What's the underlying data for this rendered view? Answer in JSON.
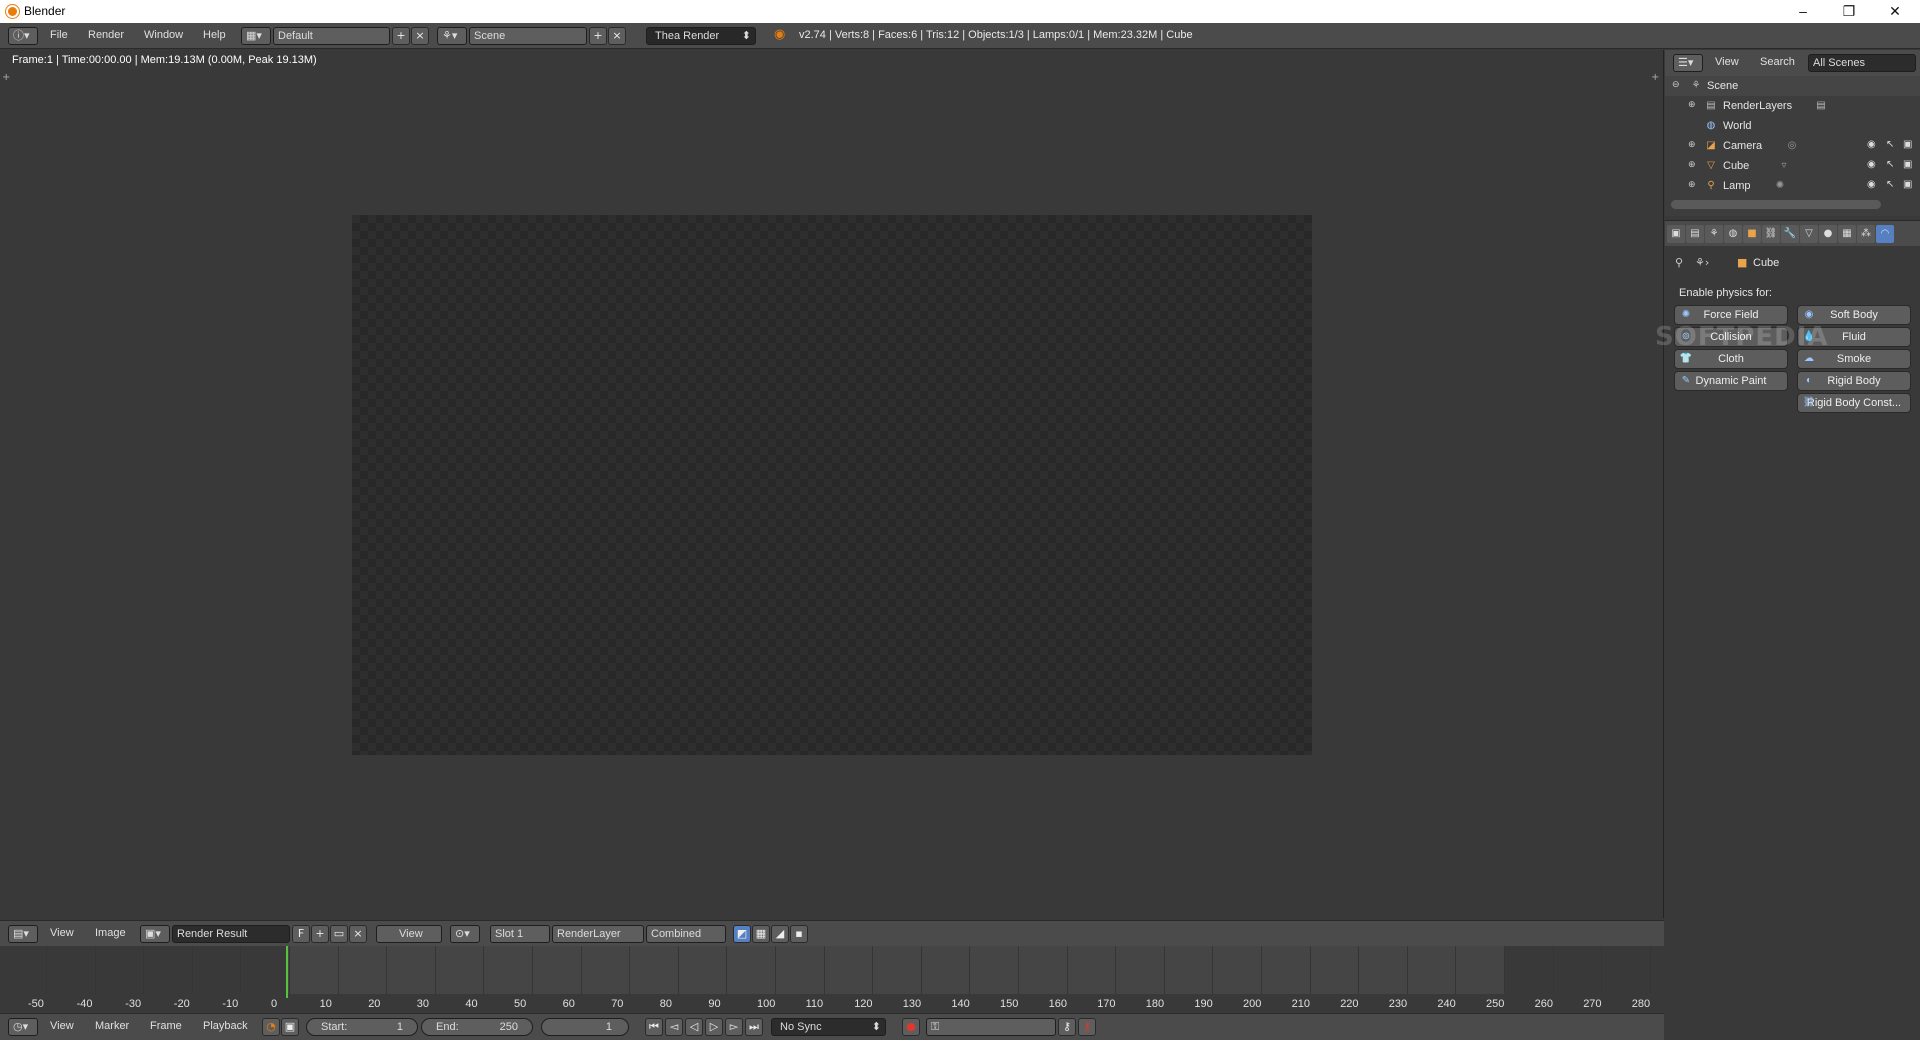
{
  "window": {
    "title": "Blender",
    "minimize": "–",
    "maximize": "❐",
    "close": "✕"
  },
  "info_header": {
    "menus": [
      "File",
      "Render",
      "Window",
      "Help"
    ],
    "layout": "Default",
    "scene": "Scene",
    "engine": "Thea Render",
    "stats": "v2.74 | Verts:8 | Faces:6 | Tris:12 | Objects:1/3 | Lamps:0/1 | Mem:23.32M | Cube"
  },
  "image_editor": {
    "frame_info": "Frame:1 | Time:00:00.00 | Mem:19.13M (0.00M, Peak 19.13M)",
    "header": {
      "menus": [
        "View",
        "Image"
      ],
      "image_name": "Render Result",
      "fake_user": "F",
      "view_mode": "View",
      "slot": "Slot 1",
      "render_layer": "RenderLayer",
      "pass": "Combined"
    }
  },
  "timeline": {
    "ticks": [
      "-50",
      "-40",
      "-30",
      "-20",
      "-10",
      "0",
      "10",
      "20",
      "30",
      "40",
      "50",
      "60",
      "70",
      "80",
      "90",
      "100",
      "110",
      "120",
      "130",
      "140",
      "150",
      "160",
      "170",
      "180",
      "190",
      "200",
      "210",
      "220",
      "230",
      "240",
      "250",
      "260",
      "270",
      "280"
    ],
    "header": {
      "menus": [
        "View",
        "Marker",
        "Frame",
        "Playback"
      ],
      "start_label": "Start:",
      "start_value": "1",
      "end_label": "End:",
      "end_value": "250",
      "current_frame": "1",
      "sync": "No Sync"
    }
  },
  "outliner": {
    "header": {
      "view": "View",
      "search": "Search",
      "filter": "All Scenes"
    },
    "items": [
      {
        "label": "Scene"
      },
      {
        "label": "RenderLayers"
      },
      {
        "label": "World"
      },
      {
        "label": "Camera"
      },
      {
        "label": "Cube"
      },
      {
        "label": "Lamp"
      }
    ]
  },
  "properties": {
    "context_object": "Cube",
    "section_label": "Enable physics for:",
    "buttons": {
      "force_field": "Force Field",
      "soft_body": "Soft Body",
      "collision": "Collision",
      "fluid": "Fluid",
      "cloth": "Cloth",
      "smoke": "Smoke",
      "dynamic_paint": "Dynamic Paint",
      "rigid_body": "Rigid Body",
      "rigid_body_constraint": "Rigid Body Const..."
    }
  },
  "watermark": "SOFTPEDIA",
  "colors": {
    "accent": "#5680c2",
    "playhead": "#56c33d",
    "brand": "#e87d0d"
  }
}
